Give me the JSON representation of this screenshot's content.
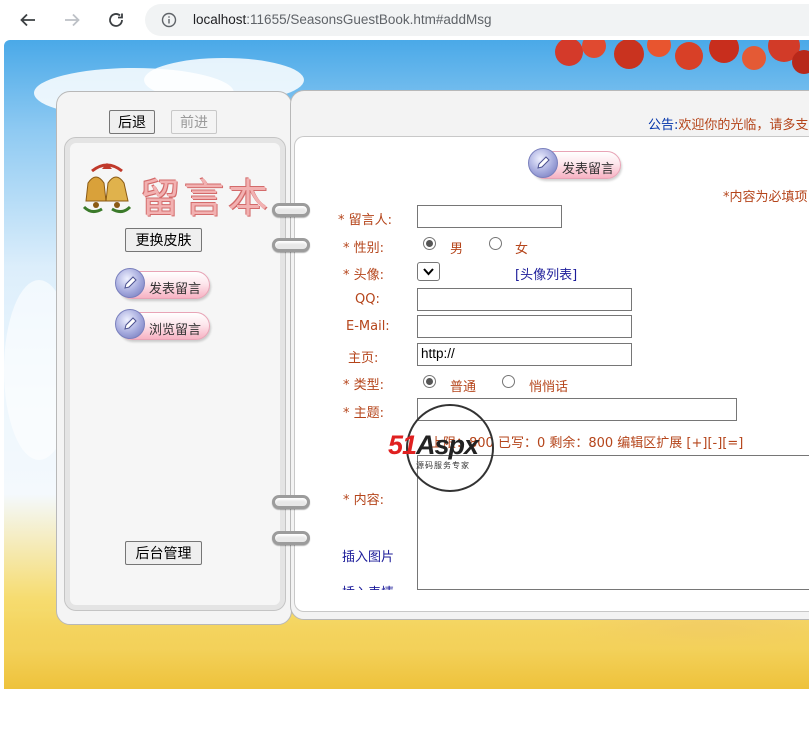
{
  "browser": {
    "url_host": "localhost",
    "url_rest": ":11655/SeasonsGuestBook.htm#addMsg"
  },
  "nav": {
    "back_label": "后退",
    "forward_label": "前进",
    "skin_label": "更换皮肤",
    "admin_label": "后台管理",
    "post_label": "发表留言",
    "browse_label": "浏览留言"
  },
  "logo": {
    "word": "留言本"
  },
  "notice": {
    "key": "公告:",
    "text": "欢迎你的光临，请多支"
  },
  "form": {
    "post_button_label": "发表留言",
    "required_note": "*内容为必填项",
    "name_label": "* 留言人:",
    "gender_label": "* 性别:",
    "gender_options": [
      "男",
      "女"
    ],
    "gender_selected": "男",
    "avatar_label": "* 头像:",
    "avatar_link": "[头像列表]",
    "qq_label": "QQ:",
    "email_label": "E-Mail:",
    "homepage_label": "主页:",
    "homepage_value": "http://",
    "type_label": "* 类型:",
    "type_options": [
      "普通",
      "悄悄话"
    ],
    "type_selected": "普通",
    "subject_label": "* 主题:",
    "counter_text": "上限：800 已写：0 剩余：800 编辑区扩展 [+][-][=]",
    "content_label": "* 内容:",
    "insert_image": "插入图片",
    "insert_emotion": "插入表情"
  },
  "watermark": {
    "brand_red": "51",
    "brand_dark": "Aspx",
    "tagline": "源码服务专家"
  },
  "colors": {
    "label": "#b5451b",
    "link": "#1c1c9a",
    "notice_key": "#0033aa"
  }
}
